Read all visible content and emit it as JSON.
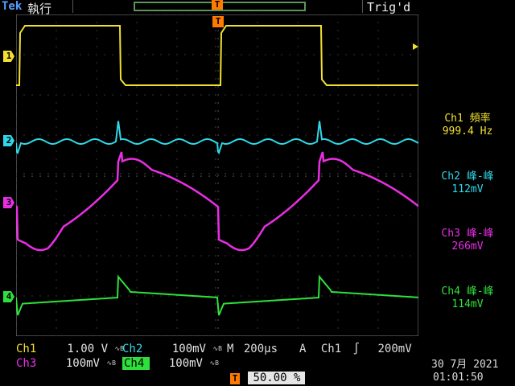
{
  "header": {
    "brand": "Tek",
    "run_state": "執行",
    "trigger_state": "Trig'd",
    "trigger_marker": "T"
  },
  "channels": [
    {
      "id": "1",
      "label": "Ch1",
      "color": "#f2e030",
      "scale": "1.00 V"
    },
    {
      "id": "2",
      "label": "Ch2",
      "color": "#2fd8e8",
      "scale": "100mV"
    },
    {
      "id": "3",
      "label": "Ch3",
      "color": "#e92ee4",
      "scale": "100mV"
    },
    {
      "id": "4",
      "label": "Ch4",
      "color": "#2fe03c",
      "scale": "100mV"
    }
  ],
  "measurements": [
    {
      "name": "Ch1 頻率",
      "value": "999.4 Hz",
      "color": "#f2e030"
    },
    {
      "name": "Ch2 峰-峰",
      "value": "112mV",
      "color": "#2fd8e8"
    },
    {
      "name": "Ch3 峰-峰",
      "value": "266mV",
      "color": "#e92ee4"
    },
    {
      "name": "Ch4 峰-峰",
      "value": "114mV",
      "color": "#2fe03c"
    }
  ],
  "timebase": {
    "mode": "M",
    "value": "200µs",
    "trigger_type": "A",
    "trigger_source": "Ch1",
    "trigger_level": "200mV",
    "trigger_position": "50.00 %"
  },
  "datetime": {
    "date": "30 7月  2021",
    "time": "01:01:50"
  }
}
